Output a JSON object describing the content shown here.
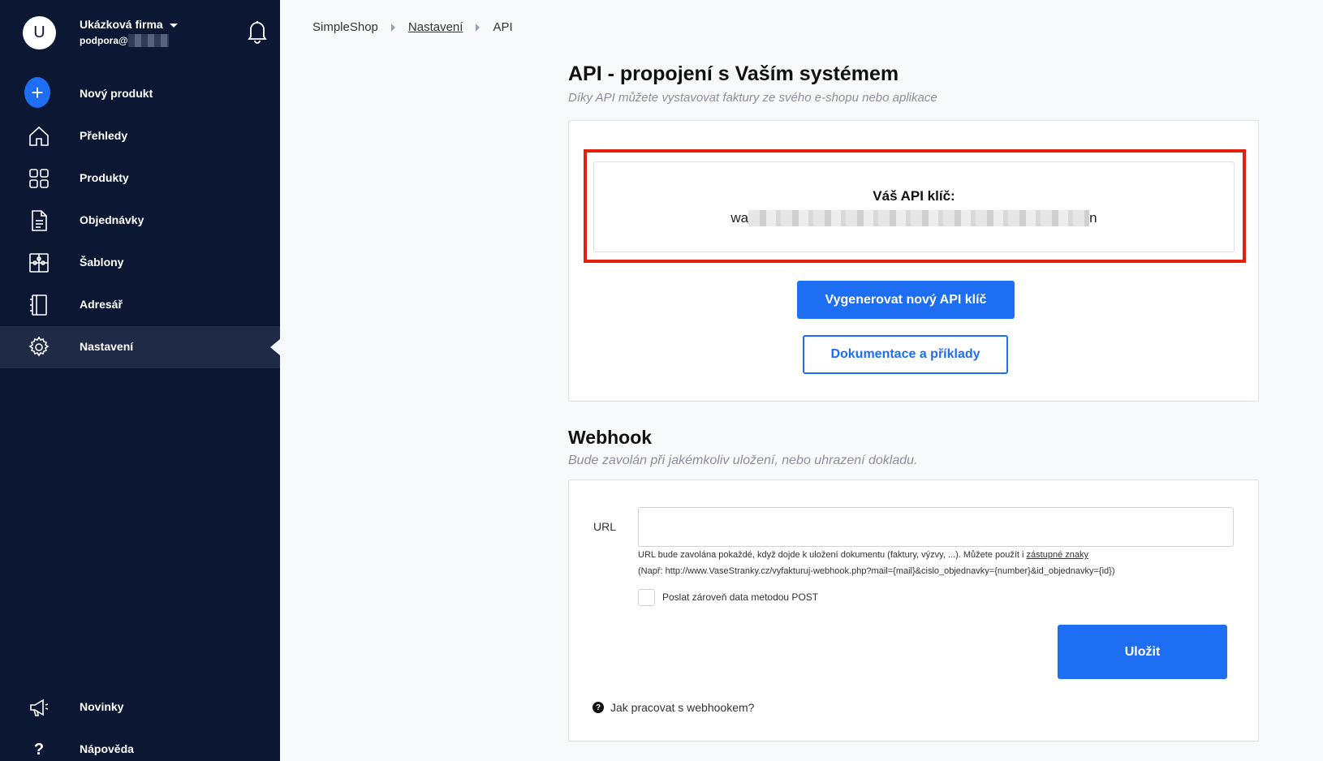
{
  "sidebar": {
    "avatar_letter": "U",
    "company": "Ukázková firma",
    "email_prefix": "podpora@",
    "nav": [
      {
        "label": "Nový produkt",
        "icon": "plus-icon"
      },
      {
        "label": "Přehledy",
        "icon": "home-icon"
      },
      {
        "label": "Produkty",
        "icon": "grid-icon"
      },
      {
        "label": "Objednávky",
        "icon": "document-icon"
      },
      {
        "label": "Šablony",
        "icon": "puzzle-icon"
      },
      {
        "label": "Adresář",
        "icon": "address-book-icon"
      },
      {
        "label": "Nastavení",
        "icon": "gear-icon",
        "active": true
      }
    ],
    "bottom": [
      {
        "label": "Novinky",
        "icon": "megaphone-icon"
      },
      {
        "label": "Nápověda",
        "icon": "question-icon"
      }
    ]
  },
  "breadcrumb": {
    "root": "SimpleShop",
    "settings": "Nastavení",
    "current": "API"
  },
  "api": {
    "title": "API - propojení s Vaším systémem",
    "subtitle": "Díky API můžete vystavovat faktury ze svého e-shopu nebo aplikace",
    "key_label": "Váš API klíč:",
    "key_start": "wa",
    "key_end": "n",
    "generate_button": "Vygenerovat nový API klíč",
    "docs_button": "Dokumentace a příklady"
  },
  "webhook": {
    "title": "Webhook",
    "subtitle": "Bude zavolán při jakémkoliv uložení, nebo uhrazení dokladu.",
    "url_label": "URL",
    "url_value": "",
    "help_text": "URL bude zavolána pokaždé, když dojde k uložení dokumentu (faktury, výzvy, ...). Můžete použít i",
    "help_link": "zástupné znaky",
    "example": "(Např: http://www.VaseStranky.cz/vyfakturuj-webhook.php?mail={mail}&cislo_objednavky={number}&id_objednavky={id})",
    "post_checkbox_label": "Poslat zároveň data metodou POST",
    "post_checked": false,
    "save_button": "Uložit",
    "how_to": "Jak pracovat s webhookem?"
  },
  "colors": {
    "sidebar_bg": "#0b1733",
    "accent": "#1e6ef4",
    "highlight": "#e2200d"
  }
}
